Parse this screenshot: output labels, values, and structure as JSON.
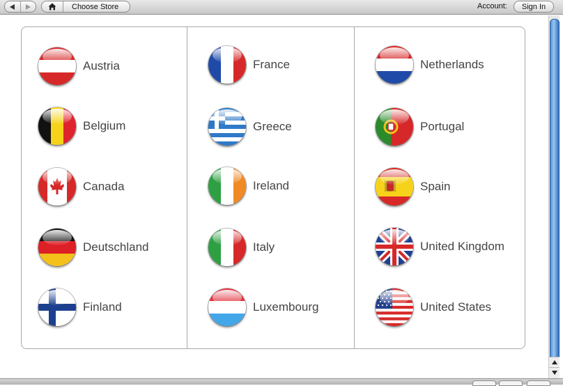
{
  "toolbar": {
    "breadcrumb_label": "Choose Store",
    "account_label": "Account:",
    "sign_in_label": "Sign In"
  },
  "columns": [
    [
      {
        "id": "austria",
        "label": "Austria",
        "flag": "austria-flag"
      },
      {
        "id": "belgium",
        "label": "Belgium",
        "flag": "belgium-flag"
      },
      {
        "id": "canada",
        "label": "Canada",
        "flag": "canada-flag"
      },
      {
        "id": "deutschland",
        "label": "Deutschland",
        "flag": "germany-flag"
      },
      {
        "id": "finland",
        "label": "Finland",
        "flag": "finland-flag"
      }
    ],
    [
      {
        "id": "france",
        "label": "France",
        "flag": "france-flag"
      },
      {
        "id": "greece",
        "label": "Greece",
        "flag": "greece-flag"
      },
      {
        "id": "ireland",
        "label": "Ireland",
        "flag": "ireland-flag"
      },
      {
        "id": "italy",
        "label": "Italy",
        "flag": "italy-flag"
      },
      {
        "id": "luxembourg",
        "label": "Luxembourg",
        "flag": "luxembourg-flag"
      }
    ],
    [
      {
        "id": "netherlands",
        "label": "Netherlands",
        "flag": "netherlands-flag"
      },
      {
        "id": "portugal",
        "label": "Portugal",
        "flag": "portugal-flag"
      },
      {
        "id": "spain",
        "label": "Spain",
        "flag": "spain-flag"
      },
      {
        "id": "united-kingdom",
        "label": "United Kingdom",
        "flag": "uk-flag"
      },
      {
        "id": "united-states",
        "label": "United States",
        "flag": "usa-flag"
      }
    ]
  ],
  "colors": {
    "scroll_thumb": "#4d8ed9",
    "label_text": "#444444",
    "panel_border": "#a8a8a8"
  }
}
